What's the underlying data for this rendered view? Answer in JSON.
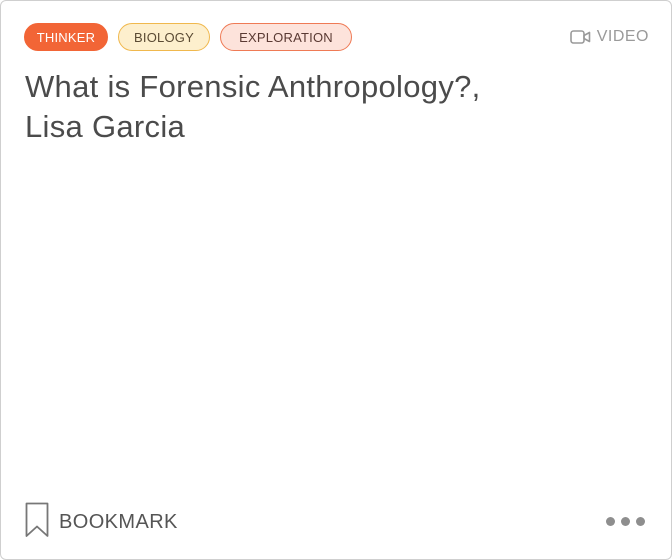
{
  "card": {
    "tags": [
      {
        "label": "THINKER"
      },
      {
        "label": "BIOLOGY"
      },
      {
        "label": "EXPLORATION"
      }
    ],
    "type_label": "VIDEO",
    "type_icon": "video-camera-icon",
    "title_line1": "What is Forensic Anthropology?,",
    "title_line2": "Lisa Garcia",
    "bookmark_label": "BOOKMARK",
    "bookmark_icon": "bookmark-icon",
    "more_icon": "more-options-icon"
  },
  "colors": {
    "tag_thinker_bg": "#f26536",
    "tag_biology_bg": "#fdefcd",
    "tag_biology_border": "#f0b84d",
    "tag_exploration_bg": "#fde3db",
    "tag_exploration_border": "#ef7a55",
    "title_text": "#4b4b4b",
    "muted_text": "#9a9a9a"
  }
}
